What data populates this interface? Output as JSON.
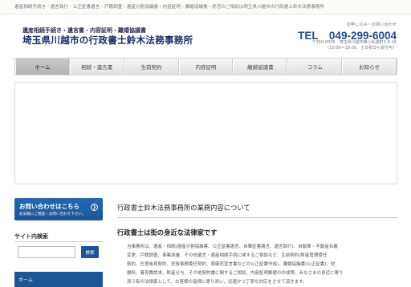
{
  "header": {
    "topbar_text": "遺産相続手続き・遺言執行・公正証書遺言・戸籍調査・遺産分割協議書・内容証明・離婚協議書・終活のご相談は埼玉県川越市の行政書士鈴木法務事務所",
    "logo_subtitle": "遺産相続手続き・遺言書・内容証明・離婚協議書",
    "logo_title": "埼玉県川越市の行政書士鈴木法務事務所",
    "contact_label": "お申し込み・お問い合わせ",
    "tel": "TEL　049-299-6004",
    "address": "〒350-0035　埼玉県川越市西小仙波町2-9-16",
    "hours": "（10:00～19:00、土日祝日も受付可）"
  },
  "nav": {
    "items": [
      {
        "label": "ホーム",
        "active": true
      },
      {
        "label": "相続・遺言書",
        "active": false
      },
      {
        "label": "生前契約",
        "active": false
      },
      {
        "label": "内容証明",
        "active": false
      },
      {
        "label": "離婚協議書",
        "active": false
      },
      {
        "label": "コラム",
        "active": false
      },
      {
        "label": "お知らせ",
        "active": false
      }
    ]
  },
  "sidebar": {
    "cta_title": "お問い合わせはこちら",
    "cta_sub": "お気軽にご相談・お問い合わせ下さい。",
    "search_heading": "サイト内検索",
    "search_value": "",
    "search_button": "検索",
    "menu_home": "ホーム"
  },
  "main": {
    "section_title": "行政書士鈴木法務事務所の業務内容について",
    "sub_title": "行政書士は街の身近な法律家です",
    "body_lines": [
      "当事務所は、遺産・相続(遺産分割協議書、公正証書遺言、自筆証書遺言、遺言執行)、自動車・不動産名義",
      "変更、戸籍調査、事業承継、その他遺言・遺産相続手続に関するご相談など、生前契約(財産管理委任",
      "契約、任意後見契約、死後事務委任契約、尊厳死宣言書などの公正証書作成)、離婚協議書(公正証書)、慰",
      "謝料、養育費請求、財産分与、その他契約書に関するご相談、内容証明郵便の作成等、みなさまの身近に寄り",
      "添う街の法律家として、お客様の皆様に寄り添い、迅速かつ丁寧な対応をさせて頂きます。"
    ]
  }
}
